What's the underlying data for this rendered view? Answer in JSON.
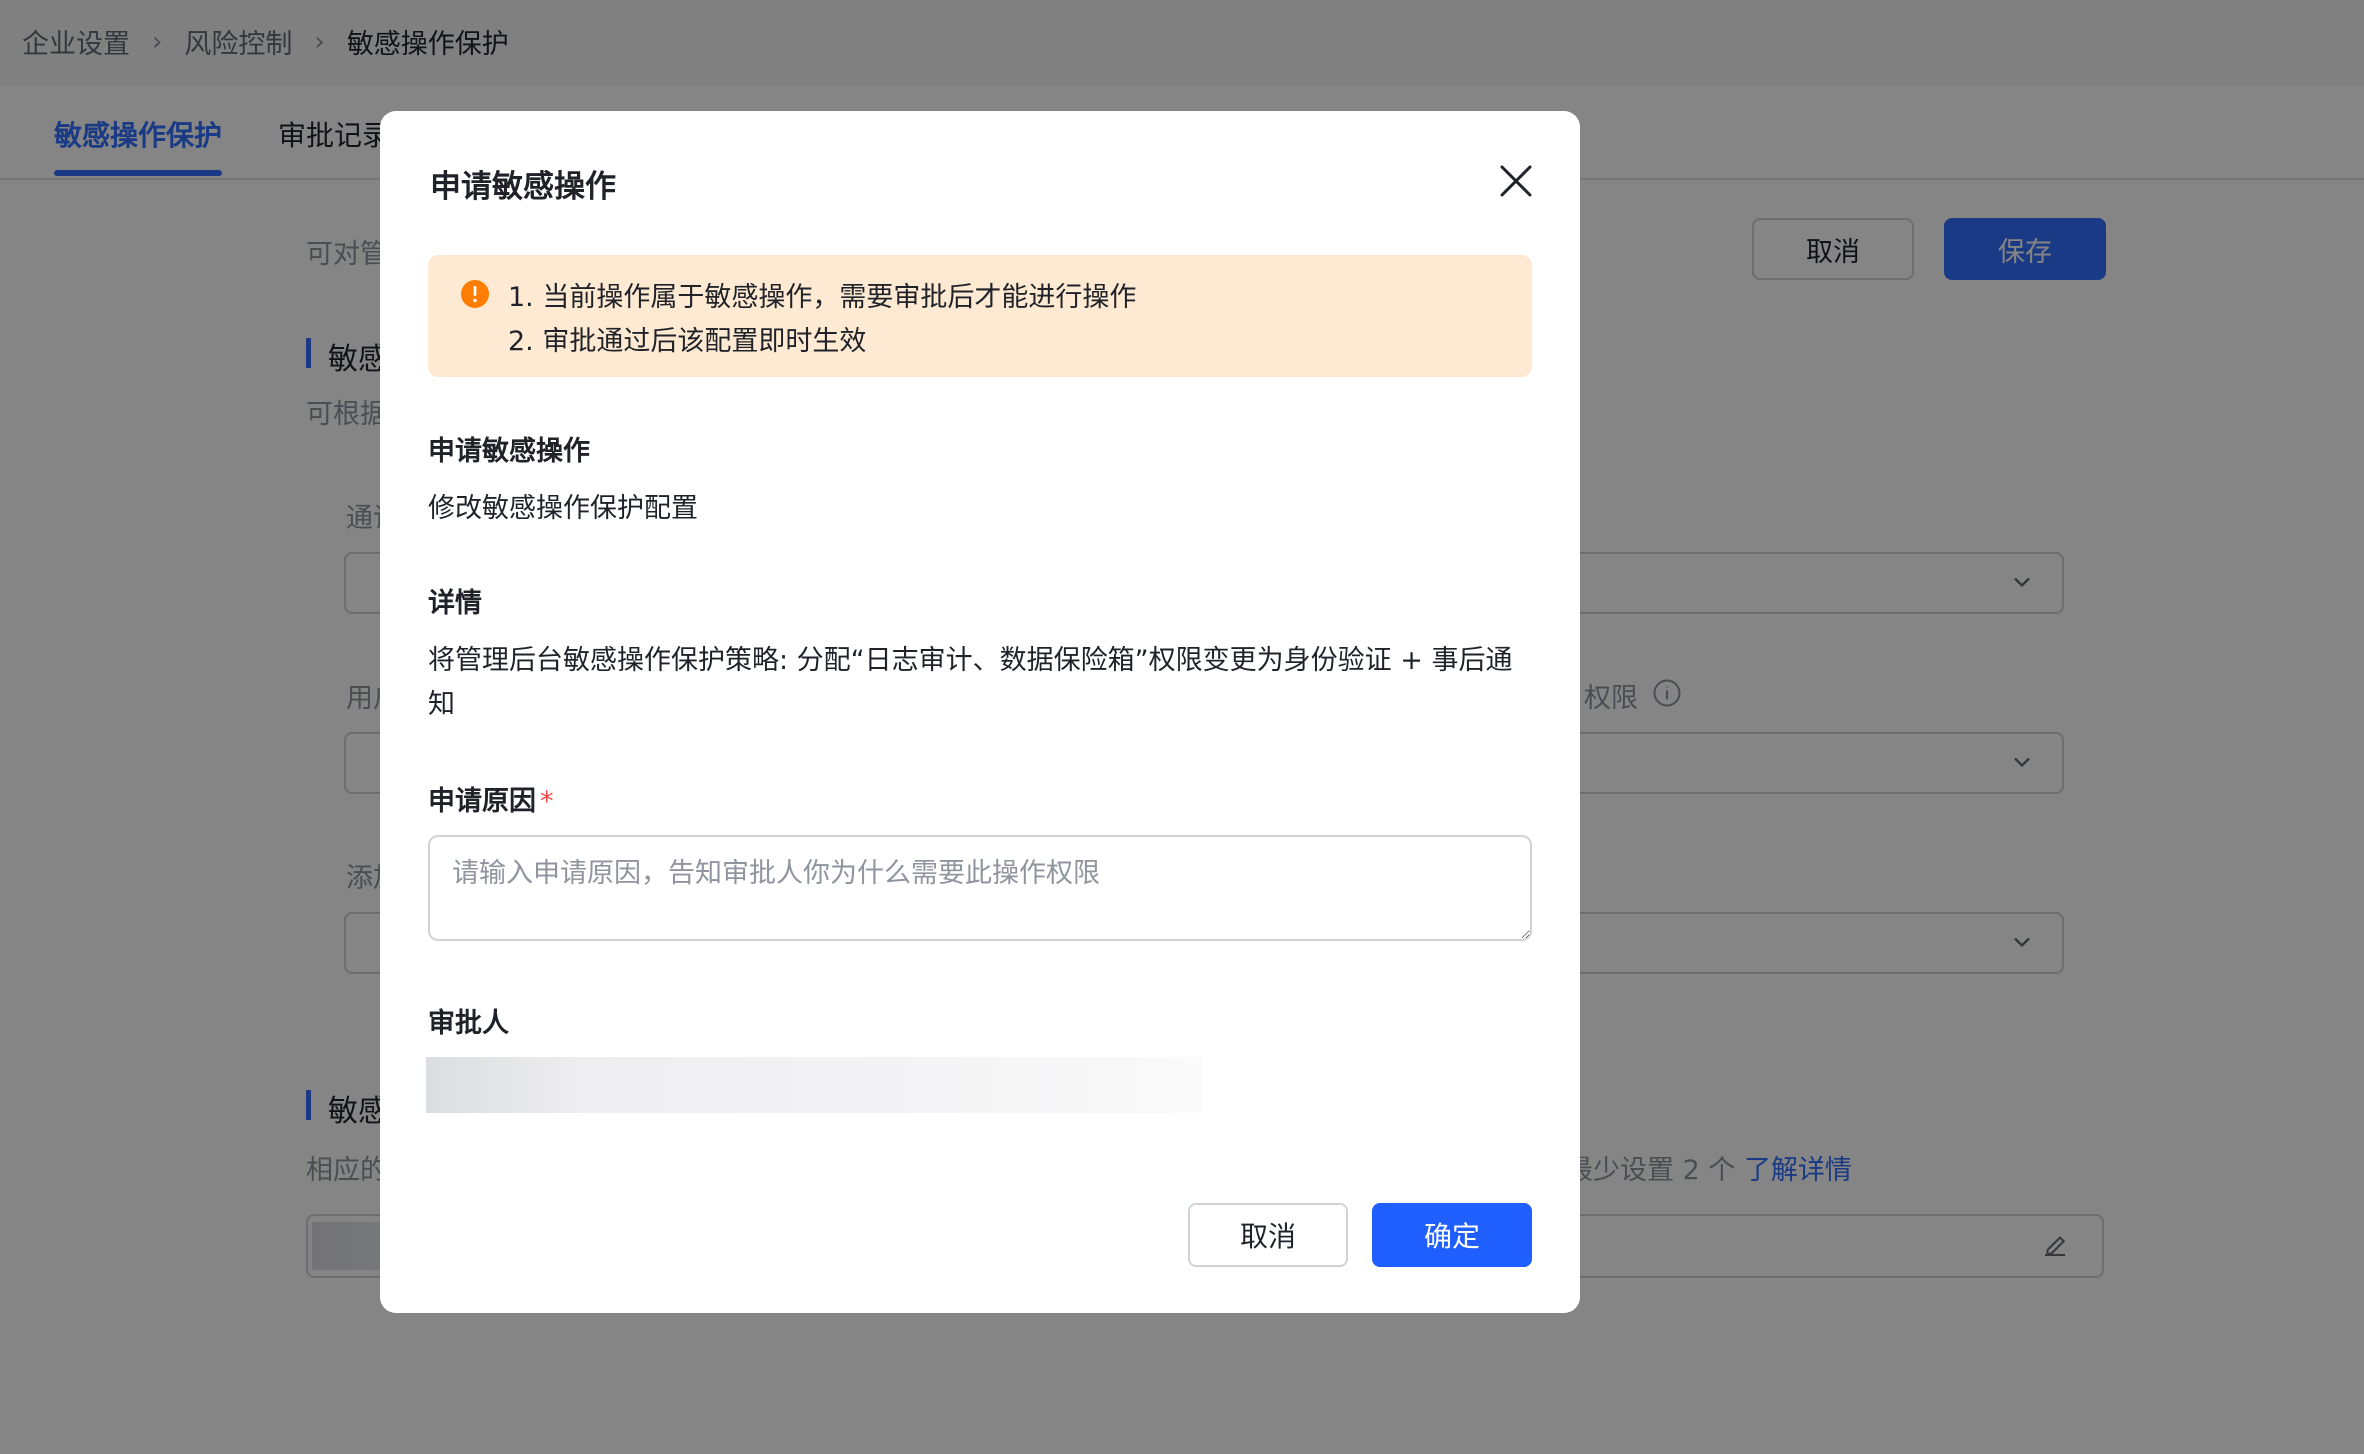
{
  "breadcrumb": {
    "items": [
      "企业设置",
      "风险控制",
      "敏感操作保护"
    ]
  },
  "tabs": [
    {
      "label": "敏感操作保护",
      "active": true
    },
    {
      "label": "审批记录",
      "active": false
    }
  ],
  "background": {
    "intro_text": "可对管",
    "cancel_label": "取消",
    "save_label": "保存",
    "section1_title": "敏感",
    "section1_desc": "可根据",
    "field1_label": "通讨",
    "field2_label": "用户",
    "field2_suffix": "权限",
    "field3_label": "添加",
    "section2_title": "敏感",
    "section2_desc": "相应的",
    "hint_text": "最少设置 2 个",
    "hint_link": "了解详情"
  },
  "modal": {
    "title": "申请敏感操作",
    "alert_lines": [
      "1. 当前操作属于敏感操作，需要审批后才能进行操作",
      "2. 审批通过后该配置即时生效"
    ],
    "operation_label": "申请敏感操作",
    "operation_value": "修改敏感操作保护配置",
    "details_label": "详情",
    "details_value": "将管理后台敏感操作保护策略: 分配“日志审计、数据保险箱”权限变更为身份验证 + 事后通知",
    "reason_label": "申请原因",
    "reason_required_mark": "*",
    "reason_placeholder": "请输入申请原因，告知审批人你为什么需要此操作权限",
    "reason_value": "",
    "approver_label": "审批人",
    "cancel_label": "取消",
    "confirm_label": "确定"
  },
  "colors": {
    "primary": "#3370ff",
    "confirm": "#1f5fff",
    "alert_bg": "#feead2",
    "alert_icon": "#ff7d00",
    "required": "#f54a45"
  },
  "icons": {
    "breadcrumb_separator": "chevron-right-icon",
    "close": "close-icon",
    "alert": "warning-circle-icon",
    "select": "chevron-down-icon",
    "info": "info-circle-icon",
    "edit": "edit-icon"
  }
}
